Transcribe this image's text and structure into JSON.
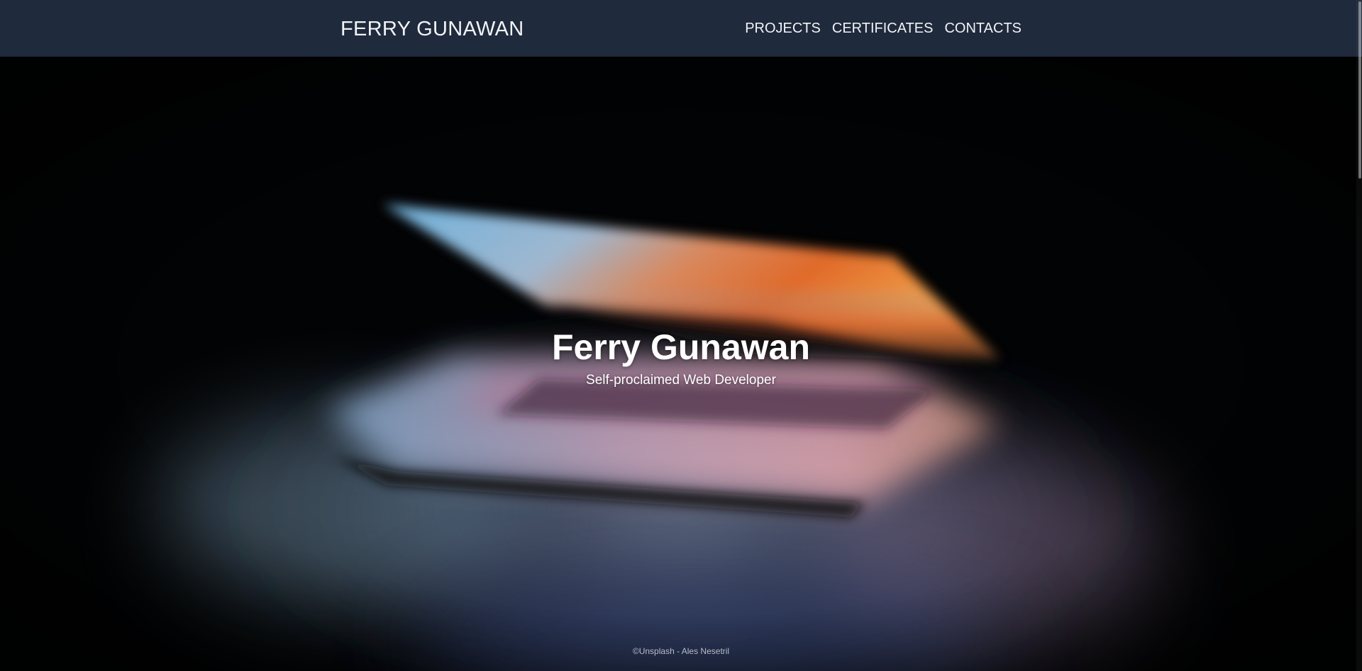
{
  "navbar": {
    "brand": "FERRY GUNAWAN",
    "links": [
      "PROJECTS",
      "CERTIFICATES",
      "CONTACTS"
    ]
  },
  "hero": {
    "title": "Ferry Gunawan",
    "subtitle": "Self-proclaimed Web Developer",
    "credit": "©Unsplash - Ales Nesetril"
  },
  "colors": {
    "navbar_bg": "#1f2a3c",
    "text": "#ffffff",
    "hero_bg": "#020304"
  }
}
